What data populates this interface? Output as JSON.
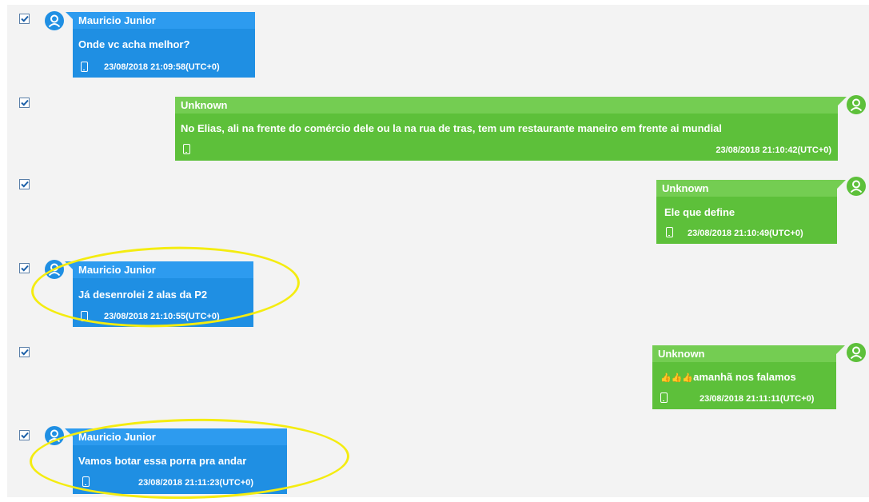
{
  "messages": [
    {
      "sender": "Mauricio Junior",
      "text": "Onde vc acha melhor?",
      "timestamp": "23/08/2018 21:09:58(UTC+0)",
      "checked": true
    },
    {
      "sender": "Unknown",
      "text": "No Elias, ali na frente do comércio dele ou la na rua de tras, tem um restaurante maneiro em frente ai mundial",
      "timestamp": "23/08/2018 21:10:42(UTC+0)",
      "checked": true
    },
    {
      "sender": "Unknown",
      "text": "Ele que define",
      "timestamp": "23/08/2018 21:10:49(UTC+0)",
      "checked": true
    },
    {
      "sender": "Mauricio Junior",
      "text": "Já desenrolei 2 alas da P2",
      "timestamp": "23/08/2018 21:10:55(UTC+0)",
      "checked": true
    },
    {
      "sender": "Unknown",
      "text": "amanhã nos falamos",
      "emoji_prefix": "👍👍👍",
      "timestamp": "23/08/2018 21:11:11(UTC+0)",
      "checked": true
    },
    {
      "sender": "Mauricio Junior",
      "text": "Vamos botar essa porra pra andar",
      "timestamp": "23/08/2018 21:11:23(UTC+0)",
      "checked": true
    }
  ],
  "icons": {
    "avatar": "user-avatar-icon",
    "device": "phone-icon",
    "checkbox": "checkbox-checked-icon"
  },
  "colors": {
    "incoming_bubble": "#1f8fe3",
    "outgoing_bubble": "#5dc03a",
    "highlight": "#f4ec10",
    "background": "#f3f3f3"
  }
}
